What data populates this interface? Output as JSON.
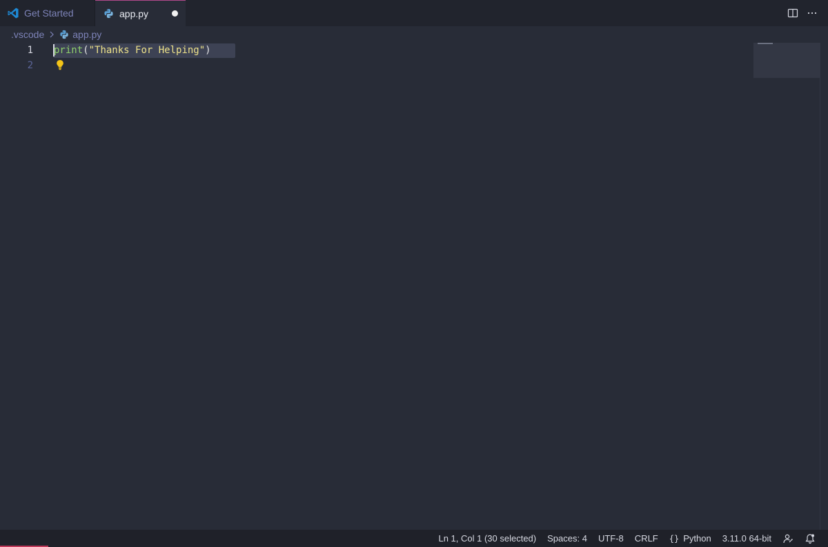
{
  "tabs": [
    {
      "label": "Get Started",
      "icon": "vscode-logo-icon",
      "active": false
    },
    {
      "label": "app.py",
      "icon": "python-file-icon",
      "active": true,
      "dirty": true
    }
  ],
  "breadcrumb": {
    "folder": ".vscode",
    "file": "app.py"
  },
  "editor": {
    "lines": [
      {
        "number": "1",
        "tokens": {
          "func": "print",
          "open": "(",
          "string": "\"Thanks For Helping\"",
          "close": ")"
        }
      },
      {
        "number": "2"
      }
    ],
    "selection": "Line 1 selected"
  },
  "statusbar": {
    "position": "Ln 1, Col 1 (30 selected)",
    "spaces": "Spaces: 4",
    "encoding": "UTF-8",
    "eol": "CRLF",
    "language_icon": "{}",
    "language": "Python",
    "interpreter": "3.11.0 64-bit"
  },
  "colors": {
    "background": "#282c37",
    "tabbar": "#21242d",
    "active_tab_border": "#b34a8c",
    "function": "#8fd16b",
    "string": "#eee28a",
    "lightbulb": "#f5c518"
  }
}
